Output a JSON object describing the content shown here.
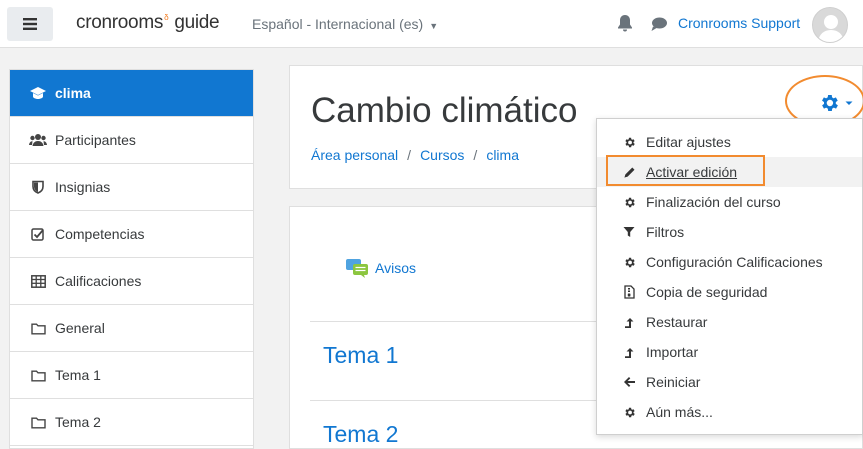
{
  "navbar": {
    "menu_icon": "hamburger-icon",
    "logo_text": "cronrooms",
    "logo_suffix": "guide",
    "language": "Español - Internacional (es)",
    "user_name": "Cronrooms Support",
    "notification_icon": "bell-icon",
    "messages_icon": "chat-icon"
  },
  "sidebar": {
    "items": [
      {
        "label": "clima",
        "icon": "graduation-cap-icon"
      },
      {
        "label": "Participantes",
        "icon": "users-icon"
      },
      {
        "label": "Insignias",
        "icon": "shield-icon"
      },
      {
        "label": "Competencias",
        "icon": "checkbox-icon"
      },
      {
        "label": "Calificaciones",
        "icon": "table-icon"
      },
      {
        "label": "General",
        "icon": "folder-icon"
      },
      {
        "label": "Tema 1",
        "icon": "folder-icon"
      },
      {
        "label": "Tema 2",
        "icon": "folder-icon"
      }
    ]
  },
  "header": {
    "title": "Cambio climático",
    "breadcrumb": [
      "Área personal",
      "Cursos",
      "clima"
    ]
  },
  "content": {
    "announcements": "Avisos",
    "sections": [
      "Tema 1",
      "Tema 2"
    ]
  },
  "menu": {
    "items": [
      {
        "label": "Editar ajustes",
        "icon": "gear-icon"
      },
      {
        "label": "Activar edición",
        "icon": "pencil-icon"
      },
      {
        "label": "Finalización del curso",
        "icon": "gear-icon"
      },
      {
        "label": "Filtros",
        "icon": "filter-icon"
      },
      {
        "label": "Configuración Calificaciones",
        "icon": "gear-icon"
      },
      {
        "label": "Copia de seguridad",
        "icon": "file-archive-icon"
      },
      {
        "label": "Restaurar",
        "icon": "level-up-icon"
      },
      {
        "label": "Importar",
        "icon": "level-up-icon"
      },
      {
        "label": "Reiniciar",
        "icon": "arrow-left-icon"
      },
      {
        "label": "Aún más...",
        "icon": "gear-icon"
      }
    ]
  },
  "colors": {
    "accent": "#1177d1",
    "highlight": "#f28b2f"
  }
}
